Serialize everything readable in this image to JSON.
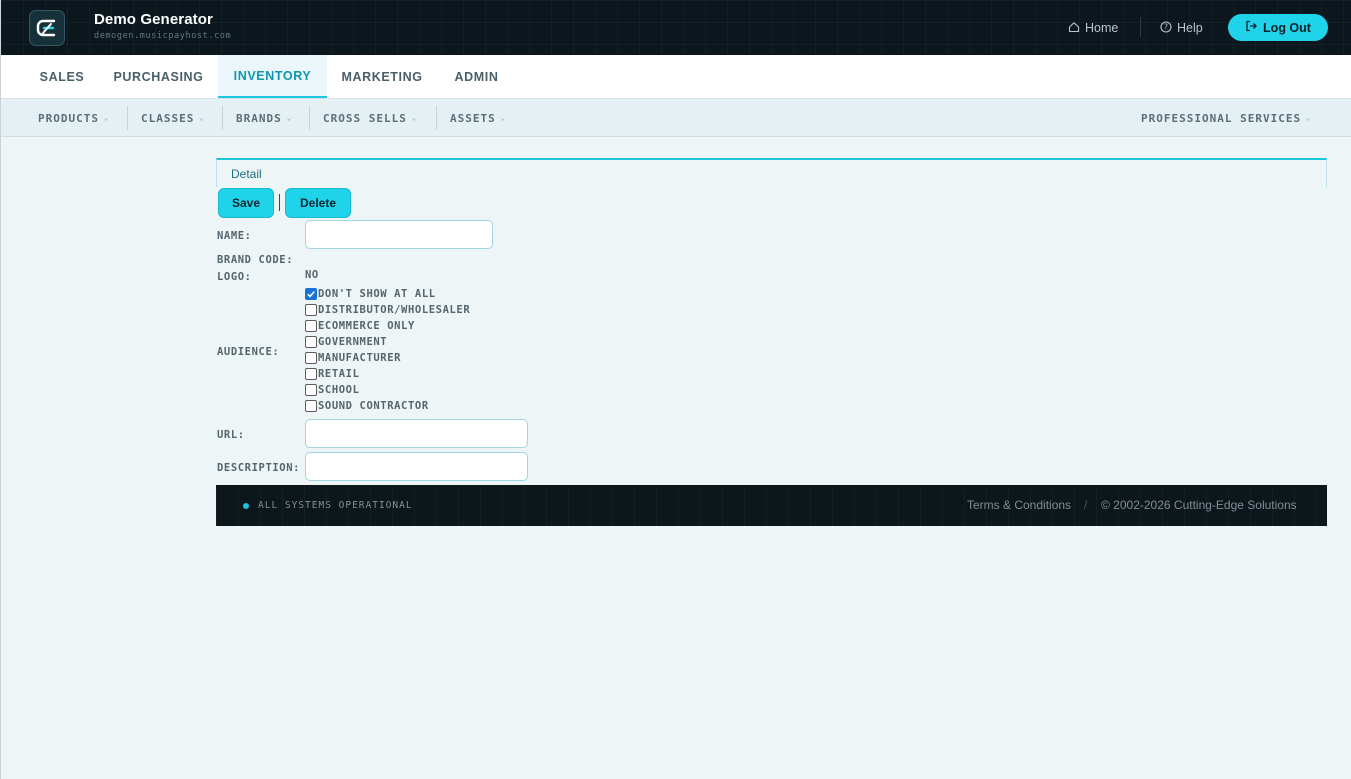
{
  "header": {
    "app_title": "Demo Generator",
    "app_subtitle": "demogen.musicpayhost.com",
    "home_label": "Home",
    "help_label": "Help",
    "logout_label": "Log Out",
    "accent_color": "#1ed3ea"
  },
  "main_nav": {
    "tabs": [
      {
        "label": "SALES",
        "active": false
      },
      {
        "label": "PURCHASING",
        "active": false
      },
      {
        "label": "INVENTORY",
        "active": true
      },
      {
        "label": "MARKETING",
        "active": false
      },
      {
        "label": "ADMIN",
        "active": false
      }
    ]
  },
  "sub_nav": {
    "items": [
      {
        "label": "PRODUCTS"
      },
      {
        "label": "CLASSES"
      },
      {
        "label": "BRANDS"
      },
      {
        "label": "CROSS SELLS"
      },
      {
        "label": "ASSETS"
      },
      {
        "label": "PROFESSIONAL SERVICES"
      }
    ]
  },
  "detail": {
    "tab_label": "Detail",
    "save_label": "Save",
    "delete_label": "Delete",
    "fields": {
      "name_label": "NAME:",
      "name_value": "",
      "brand_code_label": "BRAND CODE:",
      "logo_label": "LOGO:",
      "logo_value": "NO",
      "audience_label": "AUDIENCE:",
      "url_label": "URL:",
      "url_value": "",
      "description_label": "DESCRIPTION:",
      "description_value": ""
    },
    "audience_options": [
      {
        "label": "DON'T SHOW AT ALL",
        "checked": true
      },
      {
        "label": "DISTRIBUTOR/WHOLESALER",
        "checked": false
      },
      {
        "label": "ECOMMERCE ONLY",
        "checked": false
      },
      {
        "label": "GOVERNMENT",
        "checked": false
      },
      {
        "label": "MANUFACTURER",
        "checked": false
      },
      {
        "label": "RETAIL",
        "checked": false
      },
      {
        "label": "SCHOOL",
        "checked": false
      },
      {
        "label": "SOUND CONTRACTOR",
        "checked": false
      }
    ]
  },
  "footer": {
    "status": "ALL SYSTEMS OPERATIONAL",
    "terms_label": "Terms & Conditions",
    "separator": "/",
    "copyright": "© 2002-2026 Cutting-Edge Solutions"
  }
}
